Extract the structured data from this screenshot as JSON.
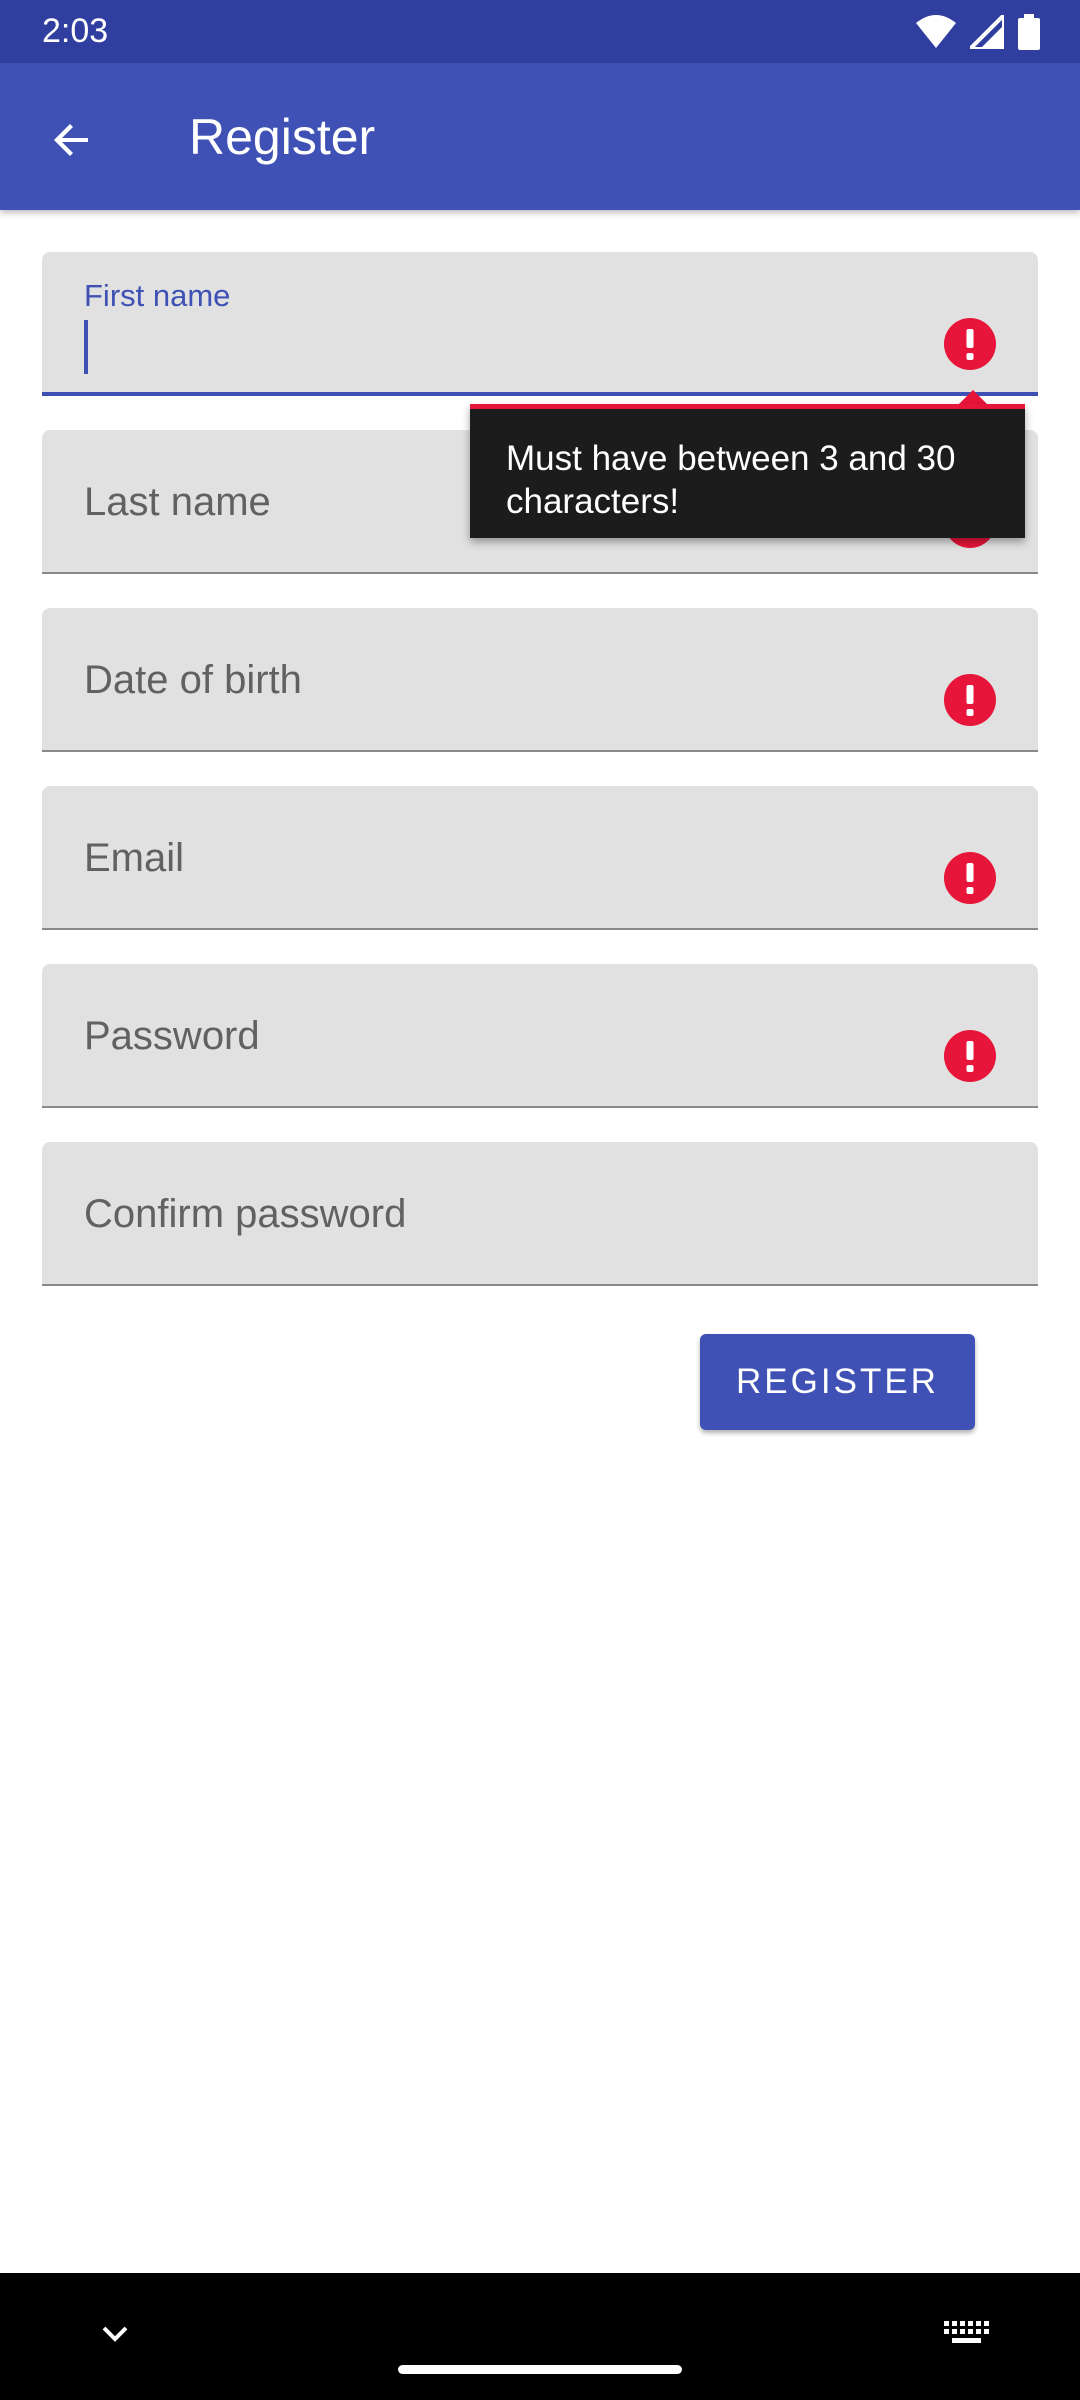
{
  "status_bar": {
    "time": "2:03",
    "icons": [
      "wifi-icon",
      "signal-icon",
      "battery-icon"
    ]
  },
  "app_bar": {
    "back_icon": "arrow-back-icon",
    "title": "Register"
  },
  "form": {
    "fields": [
      {
        "label": "First name",
        "value": "",
        "focused": true,
        "error": true
      },
      {
        "label": "Last name",
        "value": "",
        "focused": false,
        "error": true
      },
      {
        "label": "Date of birth",
        "value": "",
        "focused": false,
        "error": true
      },
      {
        "label": "Email",
        "value": "",
        "focused": false,
        "error": true
      },
      {
        "label": "Password",
        "value": "",
        "focused": false,
        "error": true
      },
      {
        "label": "Confirm password",
        "value": "",
        "focused": false,
        "error": false
      }
    ],
    "error_tooltip": "Must have between 3 and 30 characters!",
    "submit_label": "REGISTER"
  },
  "nav_bar": {
    "icons": [
      "chevron-down-icon",
      "home-handle",
      "keyboard-icon"
    ]
  },
  "colors": {
    "primary": "#3f51b5",
    "primary_dark": "#303f9f",
    "error": "#e8153a",
    "field_bg": "#e1e1e1",
    "tooltip_bg": "#1c1c1c"
  }
}
